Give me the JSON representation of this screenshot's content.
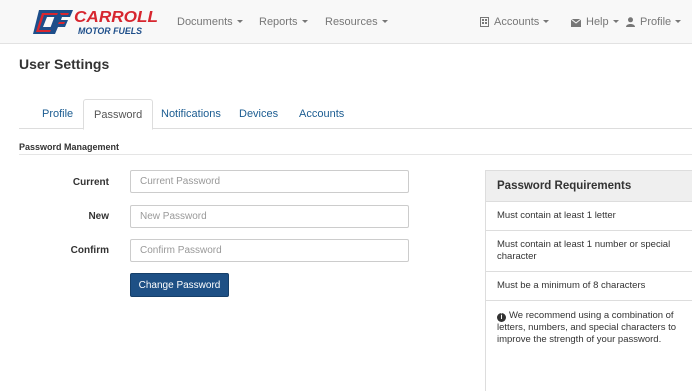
{
  "brand": {
    "name": "CARROLL",
    "sub": "MOTOR FUELS",
    "red": "#d7262f",
    "blue": "#1d4e8a"
  },
  "nav": {
    "left": [
      {
        "label": "Documents"
      },
      {
        "label": "Reports"
      },
      {
        "label": "Resources"
      }
    ],
    "right": {
      "accounts": "Accounts",
      "help": "Help",
      "profile": "Profile"
    },
    "icons": {
      "accounts": "building-icon",
      "help": "envelope-icon",
      "profile": "user-icon"
    }
  },
  "page": {
    "title": "User Settings"
  },
  "tabs": [
    {
      "label": "Profile",
      "active": false
    },
    {
      "label": "Password",
      "active": true
    },
    {
      "label": "Notifications",
      "active": false
    },
    {
      "label": "Devices",
      "active": false
    },
    {
      "label": "Accounts",
      "active": false
    }
  ],
  "section": {
    "title": "Password Management"
  },
  "form": {
    "current": {
      "label": "Current",
      "placeholder": "Current Password",
      "value": ""
    },
    "new": {
      "label": "New",
      "placeholder": "New Password",
      "value": ""
    },
    "confirm": {
      "label": "Confirm",
      "placeholder": "Confirm Password",
      "value": ""
    },
    "submit_label": "Change Password"
  },
  "requirements": {
    "title": "Password Requirements",
    "items": [
      "Must contain at least 1 letter",
      "Must contain at least 1 number or special character",
      "Must be a minimum of 8 characters"
    ],
    "note": "We recommend using a combination of letters, numbers, and special characters to improve the strength of your password."
  },
  "colors": {
    "link": "#1b5c91",
    "button": "#1e5085",
    "panel_head": "#efefef"
  }
}
